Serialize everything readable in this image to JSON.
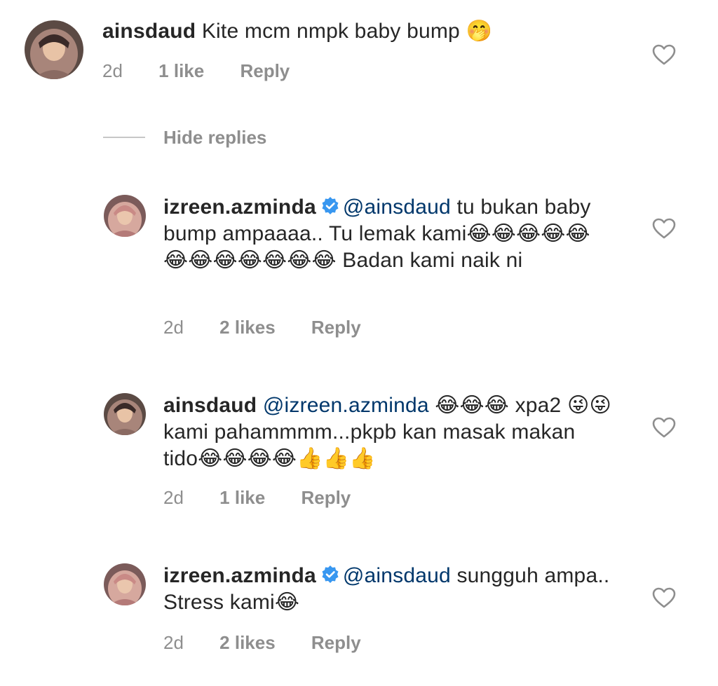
{
  "comments": [
    {
      "username": "ainsdaud",
      "text": "Kite mcm nmpk baby bump",
      "emoji": "🤭",
      "time": "2d",
      "likes": "1 like",
      "reply": "Reply"
    },
    {
      "username": "izreen.azminda",
      "verified": true,
      "mention": "@ainsdaud",
      "text": " tu bukan baby bump ampaaaa.. Tu lemak kami😂😂😂😂😂😂😂😂😂😂😂😂 Badan kami naik ni",
      "time": "2d",
      "likes": "2 likes",
      "reply": "Reply"
    },
    {
      "username": "ainsdaud",
      "mention": "@izreen.azminda",
      "text": " 😂😂😂 xpa2 😜😜kami pahammmm...pkpb kan masak makan tido😂😂😂😂👍👍👍",
      "time": "2d",
      "likes": "1 like",
      "reply": "Reply"
    },
    {
      "username": "izreen.azminda",
      "verified": true,
      "mention": "@ainsdaud",
      "text": " sungguh ampa.. Stress kami😂",
      "time": "2d",
      "likes": "2 likes",
      "reply": "Reply"
    }
  ],
  "hide_replies": "Hide replies",
  "icons": {
    "heart": "heart-outline-icon",
    "verified": "verified-badge-icon"
  },
  "colors": {
    "text": "#262626",
    "meta": "#8e8e8e",
    "mention": "#00376b",
    "verified": "#3897f0"
  }
}
